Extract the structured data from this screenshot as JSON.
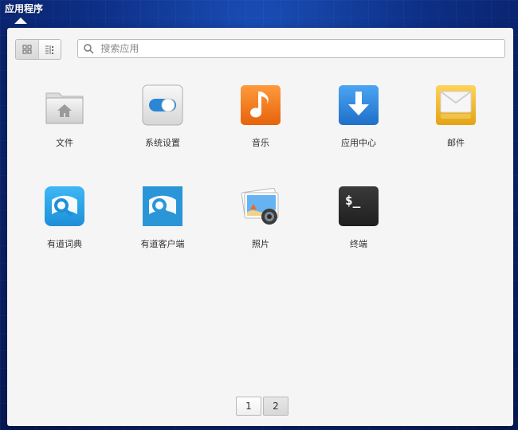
{
  "top_panel": {
    "title": "应用程序"
  },
  "search": {
    "placeholder": "搜索应用"
  },
  "apps": [
    {
      "label": "文件",
      "icon": "folder-home-icon"
    },
    {
      "label": "系统设置",
      "icon": "settings-toggle-icon"
    },
    {
      "label": "音乐",
      "icon": "music-note-icon"
    },
    {
      "label": "应用中心",
      "icon": "download-arrow-icon"
    },
    {
      "label": "邮件",
      "icon": "mail-envelope-icon"
    },
    {
      "label": "有道词典",
      "icon": "youdao-dict-icon"
    },
    {
      "label": "有道客户端",
      "icon": "youdao-client-icon"
    },
    {
      "label": "照片",
      "icon": "photos-icon"
    },
    {
      "label": "终端",
      "icon": "terminal-icon"
    }
  ],
  "pager": {
    "pages": [
      "1",
      "2"
    ],
    "current": "2"
  },
  "colors": {
    "music_orange": "#f07a1a",
    "store_blue": "#2f86d9",
    "mail_yellow": "#f1b722",
    "youdao_blue": "#2aa2e6",
    "terminal_dark": "#2a2a2a"
  }
}
